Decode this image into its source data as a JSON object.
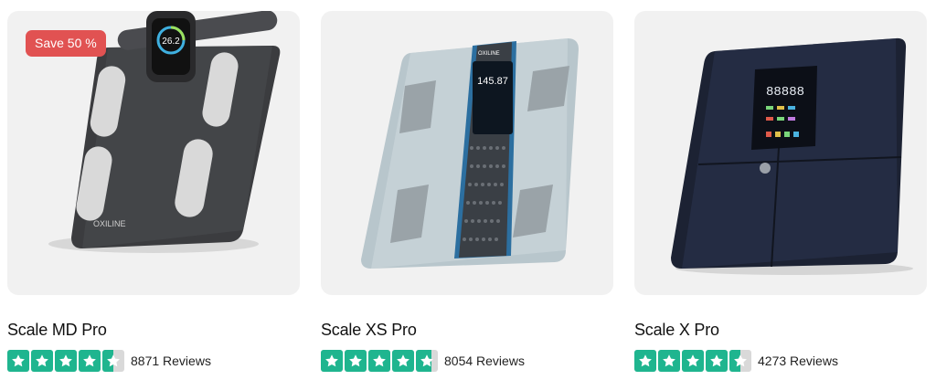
{
  "products": [
    {
      "name": "Scale MD Pro",
      "badge": "Save 50 %",
      "rating": 4.5,
      "reviews": "8871 Reviews",
      "image_icon": "body-fat-scale-with-handle"
    },
    {
      "name": "Scale XS Pro",
      "badge": "",
      "rating": 4.7,
      "reviews": "8054 Reviews",
      "image_icon": "glass-body-fat-scale"
    },
    {
      "name": "Scale X Pro",
      "badge": "",
      "rating": 4.5,
      "reviews": "4273 Reviews",
      "image_icon": "smart-scale-dark"
    }
  ],
  "images": {
    "p1": {
      "brand": "OXILINE",
      "display": "26.2"
    },
    "p2": {
      "brand": "OXILINE",
      "display": "145.87"
    },
    "p3": {
      "display": "88888"
    }
  },
  "colors": {
    "star_fill": "#1fb58f",
    "star_empty": "#d9d9d9",
    "badge_bg": "#e15252",
    "card_bg": "#f1f1f1"
  }
}
